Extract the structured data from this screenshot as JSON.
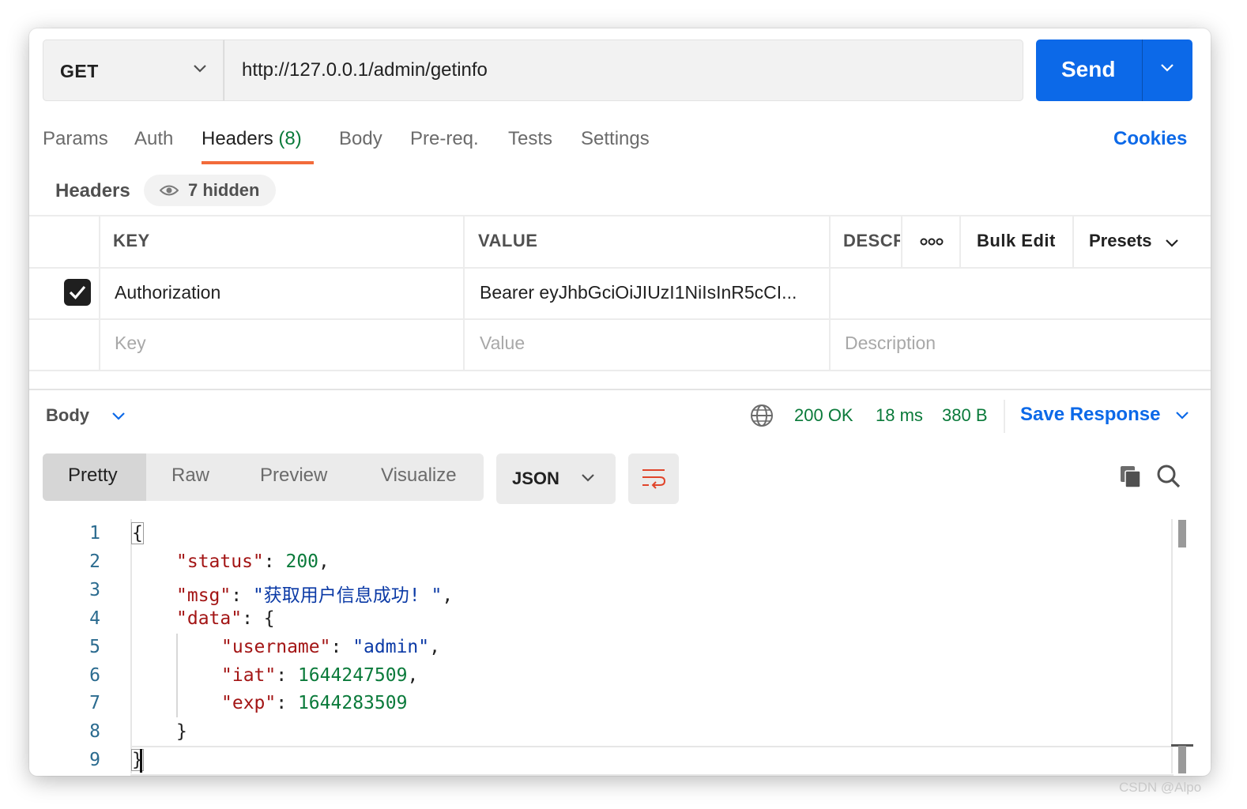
{
  "request": {
    "method": "GET",
    "url": "http://127.0.0.1/admin/getinfo",
    "send_label": "Send"
  },
  "tabs": [
    {
      "label": "Params"
    },
    {
      "label": "Auth"
    },
    {
      "label": "Headers",
      "count": "(8)"
    },
    {
      "label": "Body"
    },
    {
      "label": "Pre-req."
    },
    {
      "label": "Tests"
    },
    {
      "label": "Settings"
    }
  ],
  "cookies_label": "Cookies",
  "headers_section": {
    "title": "Headers",
    "hidden_label": "7 hidden"
  },
  "table": {
    "columns": {
      "key": "KEY",
      "value": "VALUE",
      "description": "DESCR"
    },
    "bulk_edit": "Bulk Edit",
    "presets": "Presets",
    "rows": [
      {
        "checked": true,
        "key": "Authorization",
        "value": "Bearer eyJhbGciOiJIUzI1NiIsInR5cCI..."
      }
    ],
    "placeholder": {
      "key": "Key",
      "value": "Value",
      "description": "Description"
    }
  },
  "response": {
    "body_label": "Body",
    "status": "200 OK",
    "time": "18 ms",
    "size": "380 B",
    "save_label": "Save Response",
    "view_tabs": [
      "Pretty",
      "Raw",
      "Preview",
      "Visualize"
    ],
    "format": "JSON",
    "line_numbers": [
      "1",
      "2",
      "3",
      "4",
      "5",
      "6",
      "7",
      "8",
      "9"
    ],
    "json": {
      "open": "{",
      "status_key": "\"status\"",
      "status_val": "200",
      "msg_key": "\"msg\"",
      "msg_val": "\"获取用户信息成功! \"",
      "data_key": "\"data\"",
      "data_open": "{",
      "username_key": "\"username\"",
      "username_val": "\"admin\"",
      "iat_key": "\"iat\"",
      "iat_val": "1644247509",
      "exp_key": "\"exp\"",
      "exp_val": "1644283509",
      "data_close": "}",
      "close": "}"
    }
  },
  "watermark": "CSDN @Alpo",
  "colors": {
    "accent": "#0c69e8",
    "tab_underline": "#f26b3a",
    "status_green": "#0a7a3a",
    "json_key": "#a31515",
    "json_string": "#0b3aa6",
    "json_number": "#0a7a3a"
  }
}
